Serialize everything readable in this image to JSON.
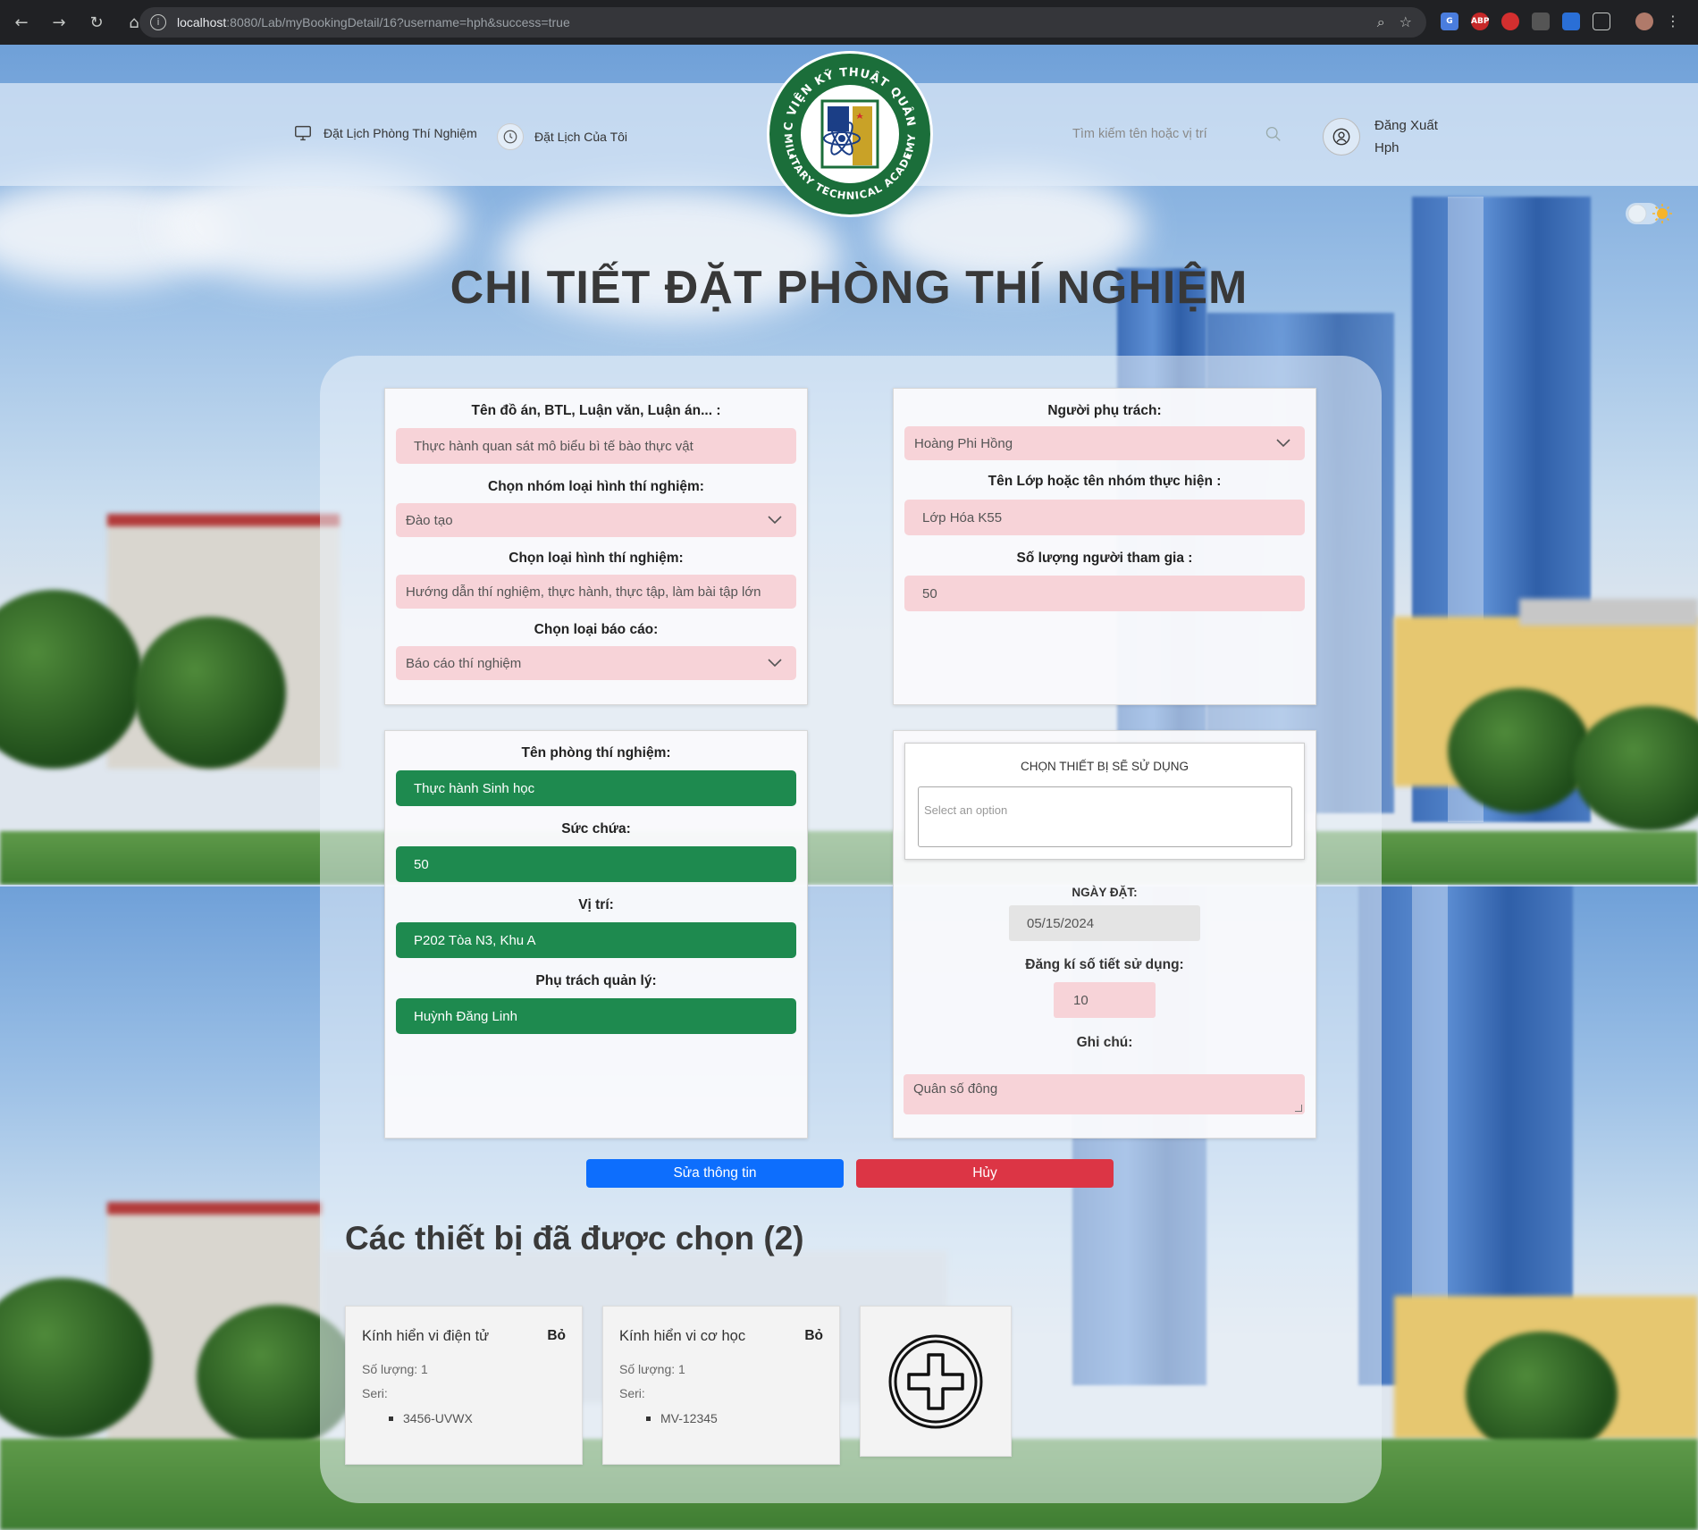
{
  "browser": {
    "url_host": "localhost",
    "url_rest": ":8080/Lab/myBookingDetail/16?username=hph&success=true"
  },
  "header": {
    "nav_booking": "Đặt Lịch Phòng Thí Nghiệm",
    "nav_my_booking": "Đặt Lịch Của Tôi",
    "search_placeholder": "Tìm kiếm tên hoặc vị trí",
    "logout": "Đăng Xuất",
    "username": "Hph"
  },
  "logo": {
    "top_text": "HỌC VIỆN KỸ THUẬT QUÂN SỰ",
    "bottom_text": "MILITARY TECHNICAL ACADEMY"
  },
  "page_title": "CHI TIẾT ĐẶT PHÒNG THÍ NGHIỆM",
  "form": {
    "project": {
      "label": "Tên đồ án, BTL, Luận văn, Luận án... :",
      "value": "Thực hành quan sát mô biểu bì tế bào thực vật"
    },
    "group_type": {
      "label": "Chọn nhóm loại hình thí nghiệm:",
      "value": "Đào tạo"
    },
    "exp_type": {
      "label": "Chọn loại hình thí nghiệm:",
      "value": "Hướng dẫn thí nghiệm, thực hành, thực tập, làm bài tập lớn"
    },
    "report_type": {
      "label": "Chọn loại báo cáo:",
      "value": "Báo cáo thí nghiệm"
    },
    "supervisor": {
      "label": "Người phụ trách:",
      "value": "Hoàng Phi Hồng"
    },
    "class_name": {
      "label": "Tên Lớp hoặc tên nhóm thực hiện :",
      "value": "Lớp Hóa K55"
    },
    "participants": {
      "label": "Số lượng người tham gia :",
      "value": "50"
    }
  },
  "lab": {
    "name": {
      "label": "Tên phòng thí nghiệm:",
      "value": "Thực hành Sinh học"
    },
    "capacity": {
      "label": "Sức chứa:",
      "value": "50"
    },
    "location": {
      "label": "Vị trí:",
      "value": "P202 Tòa N3, Khu A"
    },
    "manager": {
      "label": "Phụ trách quản lý:",
      "value": "Huỳnh Đăng Linh"
    }
  },
  "booking": {
    "equipment_title": "CHỌN THIẾT BỊ SẼ SỬ DỤNG",
    "equipment_placeholder": "Select an option",
    "date_label": "NGÀY ĐẶT:",
    "date_value": "05/15/2024",
    "periods_label": "Đăng kí số tiết sử dụng:",
    "periods_value": "10",
    "note_label": "Ghi chú:",
    "note_value": "Quân số đông"
  },
  "buttons": {
    "edit": "Sửa thông tin",
    "cancel": "Hủy"
  },
  "devices": {
    "title": "Các thiết bị đã được chọn (2)",
    "items": [
      {
        "name": "Kính hiển vi điện tử",
        "remove": "Bỏ",
        "qty": "Số lượng: 1",
        "seri_label": "Seri:",
        "serial": "3456-UVWX"
      },
      {
        "name": "Kính hiển vi cơ học",
        "remove": "Bỏ",
        "qty": "Số lượng: 1",
        "seri_label": "Seri:",
        "serial": "MV-12345"
      }
    ]
  },
  "colors": {
    "field_pink": "#f7d3d8",
    "field_green": "#1e8a4f",
    "edit_blue": "#0d6efd",
    "cancel_red": "#dc3545"
  },
  "icons": [
    "monitor-icon",
    "clock-icon",
    "search-icon",
    "user-icon",
    "chevron-down-icon",
    "plus-circle-icon",
    "theme-toggle-icon"
  ]
}
